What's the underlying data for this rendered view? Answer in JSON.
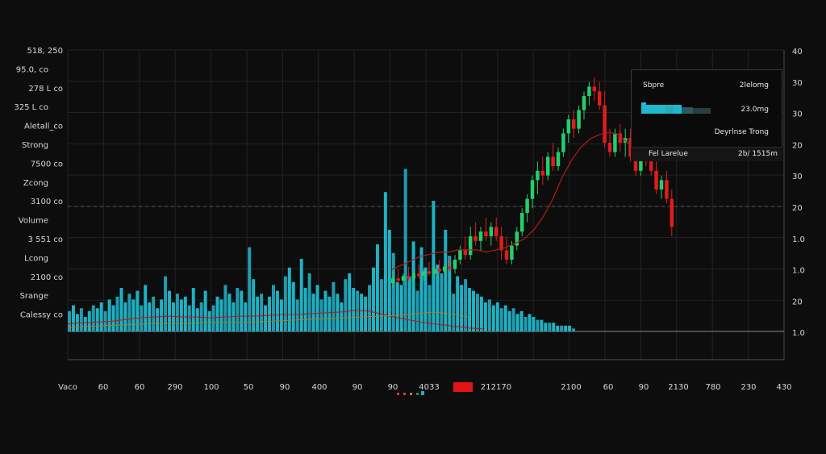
{
  "chart_data": {
    "type": "candlestick",
    "left_labels": [
      "518, 250",
      "95.0, co",
      "278 L co",
      "325 L co",
      "Aletall_co",
      "Strong",
      "7500 co",
      "Zcong",
      "3100 co",
      "Volume",
      "3 551 co",
      "Lcong",
      "2100 co",
      "Srange",
      "Calessy co"
    ],
    "right_labels": [
      "40",
      "30",
      "30",
      "20",
      "30",
      "20",
      "1.0",
      "1.0",
      "20",
      "1.0"
    ],
    "bottom_labels": [
      "Vaco",
      "60",
      "60",
      "290",
      "100",
      "50",
      "90",
      "400",
      "90",
      "90",
      "4033",
      "212170",
      "2100",
      "60",
      "90",
      "2130",
      "780",
      "230",
      "430"
    ],
    "legend": {
      "title": "Sbpre",
      "value1": "2lelomg",
      "value2": "23.0mg",
      "caption": "Deyrlnse Trong",
      "footer_label": "Fel Larelue",
      "footer_value": "2b/ 1515m"
    },
    "price_range": [
      0,
      100
    ],
    "volume_range": [
      0,
      100
    ],
    "candles": [
      {
        "o": 10,
        "h": 15,
        "l": 8,
        "c": 12
      },
      {
        "o": 12,
        "h": 16,
        "l": 10,
        "c": 11
      },
      {
        "o": 11,
        "h": 14,
        "l": 9,
        "c": 13
      },
      {
        "o": 13,
        "h": 17,
        "l": 11,
        "c": 12
      },
      {
        "o": 12,
        "h": 15,
        "l": 10,
        "c": 14
      },
      {
        "o": 14,
        "h": 18,
        "l": 12,
        "c": 13
      },
      {
        "o": 13,
        "h": 16,
        "l": 11,
        "c": 15
      },
      {
        "o": 15,
        "h": 19,
        "l": 13,
        "c": 14
      },
      {
        "o": 14,
        "h": 17,
        "l": 12,
        "c": 16
      },
      {
        "o": 16,
        "h": 20,
        "l": 14,
        "c": 15
      },
      {
        "o": 15,
        "h": 18,
        "l": 13,
        "c": 17
      },
      {
        "o": 17,
        "h": 21,
        "l": 15,
        "c": 16
      },
      {
        "o": 16,
        "h": 22,
        "l": 14,
        "c": 20
      },
      {
        "o": 20,
        "h": 26,
        "l": 18,
        "c": 24
      },
      {
        "o": 24,
        "h": 30,
        "l": 20,
        "c": 22
      },
      {
        "o": 22,
        "h": 34,
        "l": 20,
        "c": 30
      },
      {
        "o": 30,
        "h": 36,
        "l": 26,
        "c": 28
      },
      {
        "o": 28,
        "h": 34,
        "l": 24,
        "c": 32
      },
      {
        "o": 32,
        "h": 38,
        "l": 28,
        "c": 30
      },
      {
        "o": 30,
        "h": 36,
        "l": 26,
        "c": 34
      },
      {
        "o": 34,
        "h": 38,
        "l": 28,
        "c": 30
      },
      {
        "o": 30,
        "h": 34,
        "l": 20,
        "c": 24
      },
      {
        "o": 24,
        "h": 30,
        "l": 18,
        "c": 20
      },
      {
        "o": 20,
        "h": 28,
        "l": 18,
        "c": 26
      },
      {
        "o": 26,
        "h": 34,
        "l": 24,
        "c": 32
      },
      {
        "o": 32,
        "h": 42,
        "l": 30,
        "c": 40
      },
      {
        "o": 40,
        "h": 48,
        "l": 36,
        "c": 46
      },
      {
        "o": 46,
        "h": 56,
        "l": 42,
        "c": 54
      },
      {
        "o": 54,
        "h": 62,
        "l": 48,
        "c": 58
      },
      {
        "o": 58,
        "h": 64,
        "l": 52,
        "c": 56
      },
      {
        "o": 56,
        "h": 66,
        "l": 54,
        "c": 64
      },
      {
        "o": 64,
        "h": 70,
        "l": 58,
        "c": 60
      },
      {
        "o": 60,
        "h": 68,
        "l": 58,
        "c": 66
      },
      {
        "o": 66,
        "h": 76,
        "l": 64,
        "c": 74
      },
      {
        "o": 74,
        "h": 82,
        "l": 70,
        "c": 80
      },
      {
        "o": 80,
        "h": 84,
        "l": 72,
        "c": 76
      },
      {
        "o": 76,
        "h": 86,
        "l": 74,
        "c": 84
      },
      {
        "o": 84,
        "h": 92,
        "l": 80,
        "c": 90
      },
      {
        "o": 90,
        "h": 96,
        "l": 86,
        "c": 94
      },
      {
        "o": 94,
        "h": 98,
        "l": 88,
        "c": 92
      },
      {
        "o": 92,
        "h": 96,
        "l": 84,
        "c": 86
      },
      {
        "o": 86,
        "h": 92,
        "l": 68,
        "c": 70
      },
      {
        "o": 70,
        "h": 76,
        "l": 64,
        "c": 66
      },
      {
        "o": 66,
        "h": 76,
        "l": 64,
        "c": 74
      },
      {
        "o": 74,
        "h": 78,
        "l": 66,
        "c": 70
      },
      {
        "o": 70,
        "h": 76,
        "l": 64,
        "c": 72
      },
      {
        "o": 72,
        "h": 76,
        "l": 62,
        "c": 64
      },
      {
        "o": 64,
        "h": 70,
        "l": 56,
        "c": 58
      },
      {
        "o": 58,
        "h": 76,
        "l": 56,
        "c": 74
      },
      {
        "o": 74,
        "h": 78,
        "l": 60,
        "c": 62
      },
      {
        "o": 62,
        "h": 66,
        "l": 56,
        "c": 58
      },
      {
        "o": 58,
        "h": 62,
        "l": 48,
        "c": 50
      },
      {
        "o": 50,
        "h": 56,
        "l": 46,
        "c": 54
      },
      {
        "o": 54,
        "h": 58,
        "l": 44,
        "c": 46
      },
      {
        "o": 46,
        "h": 50,
        "l": 30,
        "c": 34
      }
    ],
    "moving_average": [
      14,
      16,
      18,
      20,
      21,
      22,
      22,
      23,
      23,
      23,
      22,
      23,
      24,
      26,
      28,
      32,
      38,
      46,
      56,
      64,
      70,
      74,
      76,
      77,
      76,
      72,
      68
    ],
    "volume": [
      7,
      9,
      6,
      8,
      5,
      7,
      9,
      8,
      10,
      7,
      11,
      9,
      12,
      15,
      10,
      13,
      11,
      14,
      9,
      16,
      10,
      12,
      8,
      11,
      19,
      14,
      10,
      13,
      11,
      12,
      9,
      15,
      8,
      10,
      14,
      7,
      9,
      12,
      11,
      16,
      13,
      10,
      15,
      14,
      10,
      29,
      18,
      12,
      13,
      9,
      12,
      16,
      14,
      11,
      19,
      22,
      17,
      11,
      25,
      15,
      20,
      13,
      16,
      11,
      14,
      12,
      17,
      13,
      10,
      18,
      20,
      15,
      14,
      13,
      12,
      16,
      22,
      30,
      18,
      48,
      35,
      27,
      17,
      16,
      56,
      19,
      31,
      14,
      29,
      22,
      16,
      45,
      23,
      20,
      35,
      26,
      13,
      19,
      16,
      18,
      15,
      14,
      13,
      12,
      10,
      11,
      9,
      10,
      8,
      9,
      7,
      8,
      6,
      7,
      5,
      6,
      5,
      4,
      4,
      3,
      3,
      3,
      2,
      2,
      2,
      2,
      1
    ],
    "volume_ma": [
      9,
      10,
      11,
      12,
      14,
      16,
      17,
      18,
      17,
      17,
      16,
      17,
      18,
      18,
      19,
      20,
      20,
      21,
      22,
      23,
      25,
      24,
      20,
      16,
      13,
      10,
      8,
      6,
      4,
      3
    ],
    "volume_ma2": [
      5,
      6,
      7,
      8,
      9,
      10,
      10,
      10,
      11,
      11,
      11,
      12,
      13,
      14,
      15,
      16,
      17,
      18,
      19,
      20,
      22,
      24,
      22,
      18
    ]
  }
}
